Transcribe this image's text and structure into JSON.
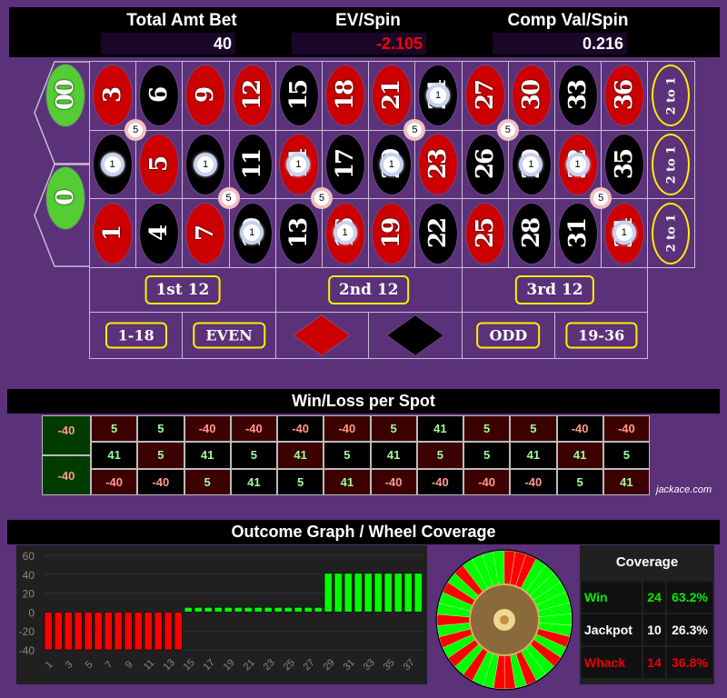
{
  "header": {
    "total_bet_label": "Total Amt Bet",
    "total_bet": "40",
    "ev_label": "EV/Spin",
    "ev": "-2.105",
    "comp_label": "Comp Val/Spin",
    "comp": "0.216"
  },
  "colors": {
    "felt": "#5b317a",
    "red": "#cc0000",
    "black": "#000000",
    "green": "#55cc33",
    "win": "#00ff00",
    "whack": "#ff0000",
    "ev_negative": "#ff0000"
  },
  "board": {
    "zeros": [
      "00",
      "0"
    ],
    "rows": [
      [
        3,
        6,
        9,
        12,
        15,
        18,
        21,
        24,
        27,
        30,
        33,
        36
      ],
      [
        2,
        5,
        8,
        11,
        14,
        17,
        20,
        23,
        26,
        29,
        32,
        35
      ],
      [
        1,
        4,
        7,
        10,
        13,
        16,
        19,
        22,
        25,
        28,
        31,
        34
      ]
    ],
    "red_numbers": [
      1,
      3,
      5,
      7,
      9,
      12,
      14,
      16,
      18,
      19,
      21,
      23,
      25,
      27,
      30,
      32,
      34,
      36
    ],
    "column_label": "2 to 1",
    "dozens": [
      "1st 12",
      "2nd 12",
      "3rd 12"
    ],
    "outside": [
      "1-18",
      "EVEN",
      "red-diamond",
      "black-diamond",
      "ODD",
      "19-36"
    ],
    "straight_chips": {
      "amount": "1",
      "numbers": [
        24,
        2,
        8,
        14,
        20,
        29,
        32,
        10,
        16,
        34
      ]
    },
    "corner_chips": {
      "amount": "5",
      "corners": [
        [
          2,
          3,
          5,
          6
        ],
        [
          20,
          21,
          23,
          24
        ],
        [
          26,
          27,
          29,
          30
        ],
        [
          7,
          8,
          10,
          11
        ],
        [
          13,
          14,
          16,
          17
        ],
        [
          31,
          32,
          34,
          35
        ]
      ]
    }
  },
  "winloss": {
    "title": "Win/Loss per Spot",
    "zeros": [
      "-40",
      "-40"
    ],
    "rows": [
      [
        "5",
        "5",
        "-40",
        "-40",
        "-40",
        "-40",
        "5",
        "41",
        "5",
        "5",
        "-40",
        "-40"
      ],
      [
        "41",
        "5",
        "41",
        "5",
        "41",
        "5",
        "41",
        "5",
        "5",
        "41",
        "41",
        "5"
      ],
      [
        "-40",
        "-40",
        "5",
        "41",
        "5",
        "41",
        "-40",
        "-40",
        "-40",
        "-40",
        "5",
        "41"
      ]
    ],
    "credit": "jackace.com"
  },
  "outcome": {
    "title": "Outcome Graph / Wheel Coverage"
  },
  "chart_data": {
    "type": "bar",
    "x": [
      1,
      2,
      3,
      4,
      5,
      6,
      7,
      8,
      9,
      10,
      11,
      12,
      13,
      14,
      15,
      16,
      17,
      18,
      19,
      20,
      21,
      22,
      23,
      24,
      25,
      26,
      27,
      28,
      29,
      30,
      31,
      32,
      33,
      34,
      35,
      36,
      37,
      38
    ],
    "values": [
      -40,
      -40,
      -40,
      -40,
      -40,
      -40,
      -40,
      -40,
      -40,
      -40,
      -40,
      -40,
      -40,
      -40,
      5,
      5,
      5,
      5,
      5,
      5,
      5,
      5,
      5,
      5,
      5,
      5,
      5,
      5,
      41,
      41,
      41,
      41,
      41,
      41,
      41,
      41,
      41,
      41
    ],
    "ylim": [
      -40,
      60
    ],
    "yticks": [
      "60",
      "40",
      "20",
      "0",
      "-20",
      "-40"
    ],
    "xticks": [
      "1",
      "3",
      "5",
      "7",
      "9",
      "11",
      "13",
      "15",
      "17",
      "19",
      "21",
      "23",
      "25",
      "27",
      "29",
      "31",
      "33",
      "35",
      "37"
    ],
    "grid": true
  },
  "wheel": {
    "order": [
      "0",
      "28",
      "9",
      "26",
      "30",
      "11",
      "7",
      "20",
      "32",
      "17",
      "5",
      "22",
      "34",
      "15",
      "3",
      "24",
      "36",
      "13",
      "1",
      "00",
      "27",
      "10",
      "25",
      "29",
      "12",
      "8",
      "19",
      "31",
      "18",
      "6",
      "21",
      "33",
      "16",
      "4",
      "23",
      "35",
      "14",
      "2"
    ]
  },
  "coverage": {
    "title": "Coverage",
    "rows": [
      {
        "label": "Win",
        "count": "24",
        "pct": "63.2%",
        "color": "#00ee00"
      },
      {
        "label": "Jackpot",
        "count": "10",
        "pct": "26.3%",
        "color": "#ffffff"
      },
      {
        "label": "Whack",
        "count": "14",
        "pct": "36.8%",
        "color": "#ee0000"
      }
    ]
  }
}
